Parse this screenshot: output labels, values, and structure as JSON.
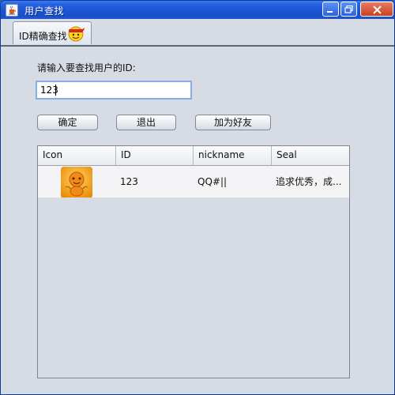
{
  "window": {
    "title": "用户查找",
    "icon": "java-cup-icon"
  },
  "tabs": [
    {
      "label": "ID精确查找",
      "icon": "smiley-ninja-icon",
      "selected": true
    }
  ],
  "form": {
    "prompt": "请输入要查找用户的ID:",
    "id_value": "123"
  },
  "buttons": {
    "confirm": "确定",
    "exit": "退出",
    "add_friend": "加为好友"
  },
  "table": {
    "columns": [
      "Icon",
      "ID",
      "nickname",
      "Seal"
    ],
    "rows": [
      {
        "icon": "cartoon-avatar",
        "id": "123",
        "nickname": "QQ#||",
        "seal": "追求优秀，成..."
      }
    ]
  },
  "colors": {
    "titlebar": "#1e55d4",
    "accent_border": "#88aee6",
    "background": "#d7dbe3"
  }
}
